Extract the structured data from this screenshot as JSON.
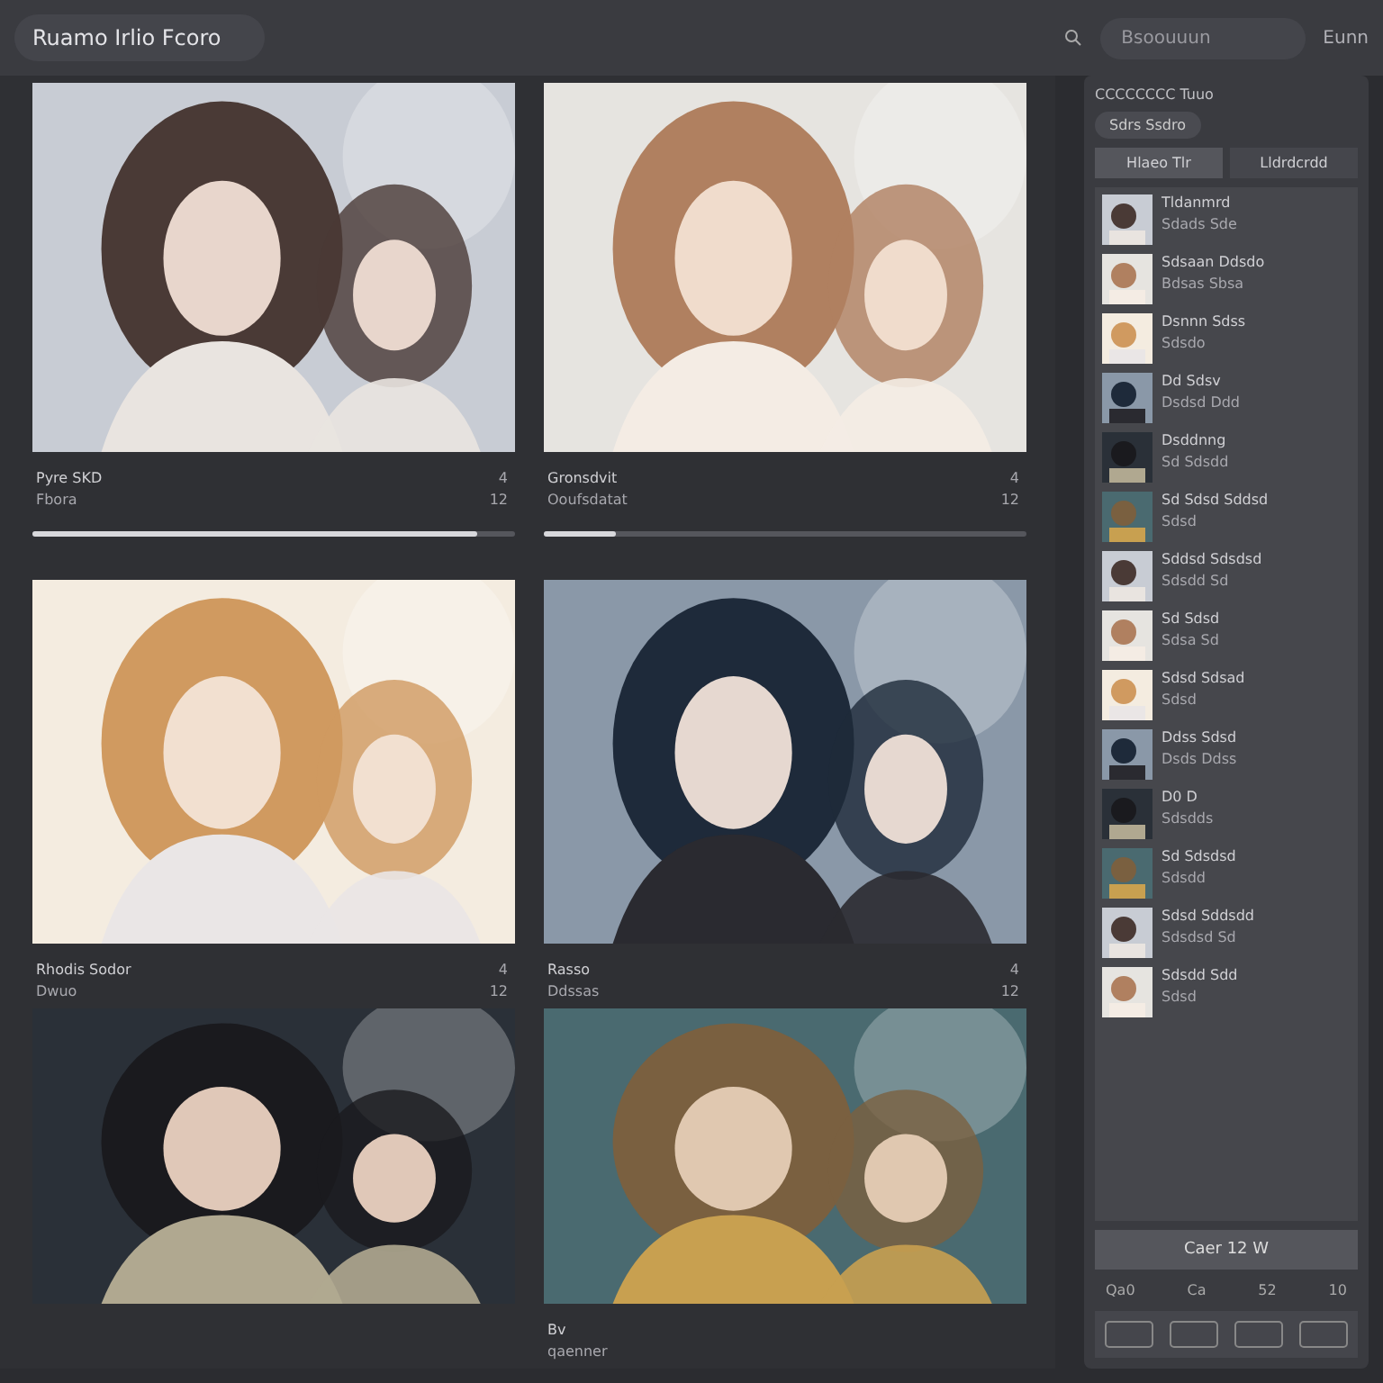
{
  "top_bar": {
    "title": "Ruamo Irlio Fcoro",
    "search": {
      "placeholder": "Bsoouuun"
    },
    "account": "Eunn"
  },
  "gallery": [
    {
      "kind": "picture",
      "title": "Pyre SKD",
      "subtitle": "Fbora",
      "count_1": "4",
      "count_2": "12",
      "progress": {
        "level": 0.92
      }
    },
    {
      "kind": "picture",
      "title": "Gronsdvit",
      "subtitle": "Ooufsdatat",
      "count_1": "4",
      "count_2": "12",
      "progress": {
        "level": 0.15
      }
    },
    {
      "kind": "picture",
      "title": "Rhodis Sodor",
      "subtitle": "Dwuo",
      "count_1": "4",
      "count_2": "12"
    },
    {
      "kind": "picture",
      "title": "Rasso",
      "subtitle": "Ddssas",
      "count_1": "4",
      "count_2": "12"
    },
    {
      "kind": "picture"
    },
    {
      "kind": "picture",
      "title": "Bv",
      "subtitle": "qaenner"
    }
  ],
  "sidebar": {
    "heading": "CCCCCCCC Tuuo",
    "chip": "Sdrs Ssdro",
    "tabs": [
      {
        "label": "Hlaeo Tlr",
        "selected": true
      },
      {
        "label": "Lldrdcrdd",
        "selected": false
      }
    ],
    "items": [
      {
        "title": "Tldanmrd",
        "subtitle": "Sdads Sde"
      },
      {
        "title": "Sdsaan Ddsdo",
        "subtitle": "Bdsas Sbsa"
      },
      {
        "title": "Dsnnn Sdss",
        "subtitle": "Sdsdo"
      },
      {
        "title": "Dd Sdsv",
        "subtitle": "Dsdsd Ddd"
      },
      {
        "title": "Dsddnng",
        "subtitle": "Sd Sdsdd"
      },
      {
        "title": "Sd Sdsd Sddsd",
        "subtitle": "Sdsd"
      },
      {
        "title": "Sddsd Sdsdsd",
        "subtitle": "Sdsdd Sd"
      },
      {
        "title": "Sd Sdsd",
        "subtitle": "Sdsa Sd"
      },
      {
        "title": "Sdsd Sdsad",
        "subtitle": "Sdsd"
      },
      {
        "title": "Ddss Sdsd",
        "subtitle": "Dsds Ddss"
      },
      {
        "title": "D0 D",
        "subtitle": "Sdsdds"
      },
      {
        "title": "Sd Sdsdsd",
        "subtitle": "Sdsdd"
      },
      {
        "title": "Sdsd Sddsdd",
        "subtitle": "Sdsdsd Sd"
      },
      {
        "title": "Sdsdd Sdd",
        "subtitle": "Sdsd"
      }
    ],
    "footer_button": "Caer 12 W",
    "controls": [
      "Qa0",
      "Ca",
      "52",
      "10"
    ]
  }
}
